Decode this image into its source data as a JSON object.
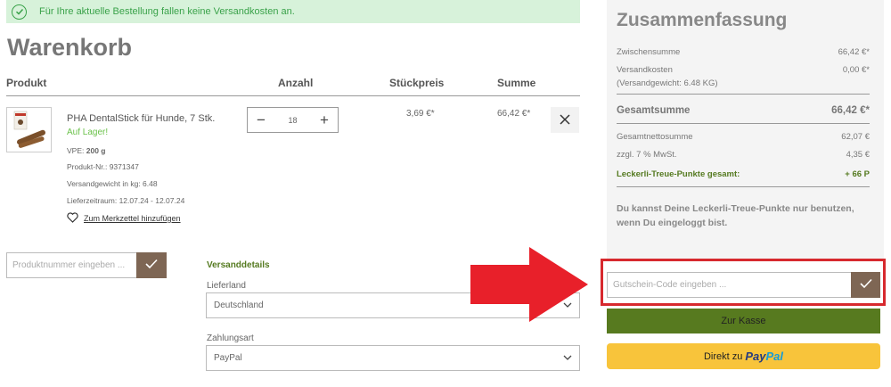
{
  "notice": {
    "text": "Für Ihre aktuelle Bestellung fallen keine Versandkosten an."
  },
  "page_title": "Warenkorb",
  "table_headers": {
    "product": "Produkt",
    "quantity": "Anzahl",
    "unit_price": "Stückpreis",
    "total": "Summe"
  },
  "cart_item": {
    "name": "PHA DentalStick für Hunde, 7 Stk.",
    "stock": "Auf Lager!",
    "vpe_label": "VPE:",
    "vpe_value": "200 g",
    "product_no": "Produkt-Nr.: 9371347",
    "shipping_weight": "Versandgewicht in kg: 6.48",
    "delivery_period": "Lieferzeitraum: 12.07.24 - 12.07.24",
    "wishlist_label": "Zum Merkzettel hinzufügen",
    "quantity": "18",
    "unit_price": "3,69 €*",
    "total": "66,42 €*"
  },
  "product_number_input": {
    "placeholder": "Produktnummer eingeben ..."
  },
  "shipping": {
    "title": "Versanddetails",
    "country_label": "Lieferland",
    "country_value": "Deutschland",
    "payment_label": "Zahlungsart",
    "payment_value": "PayPal"
  },
  "summary": {
    "title": "Zusammenfassung",
    "subtotal_label": "Zwischensumme",
    "subtotal_value": "66,42 €*",
    "shipping_label": "Versandkosten",
    "shipping_weight_label": "(Versandgewicht: 6.48 KG)",
    "shipping_value": "0,00 €*",
    "total_label": "Gesamtsumme",
    "total_value": "66,42 €*",
    "net_label": "Gesamtnettosumme",
    "net_value": "62,07 €",
    "vat_label": "zzgl. 7 % MwSt.",
    "vat_value": "4,35 €",
    "points_label": "Leckerli-Treue-Punkte gesamt:",
    "points_value": "+ 66 P",
    "points_info": "Du kannst Deine Leckerli-Treue-Punkte nur benutzen, wenn Du eingeloggt bist."
  },
  "voucher": {
    "placeholder": "Gutschein-Code eingeben ..."
  },
  "checkout_button": "Zur Kasse",
  "paypal_button": {
    "prefix": "Direkt zu",
    "pay": "Pay",
    "pal": "Pal"
  },
  "colors": {
    "notice_bg": "#d7f2da",
    "notice_text": "#3aa24a",
    "brand_green": "#577a1f",
    "brown_button": "#7e6654",
    "paypal_yellow": "#f8c43b",
    "highlight_red": "#d7292e"
  }
}
